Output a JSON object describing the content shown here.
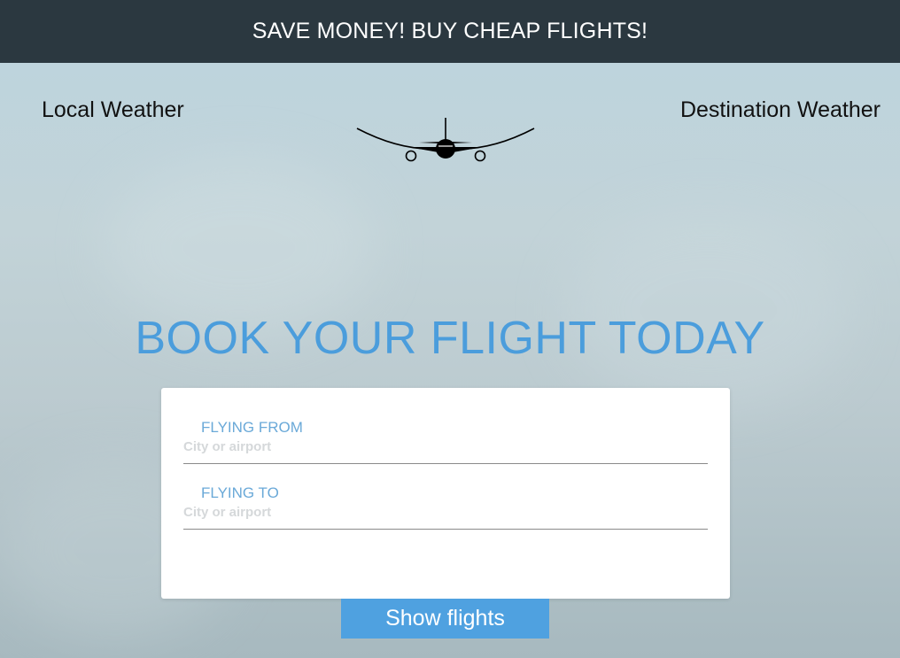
{
  "banner": {
    "text": "SAVE MONEY! BUY CHEAP FLIGHTS!"
  },
  "weather": {
    "local_label": "Local Weather",
    "destination_label": "Destination Weather"
  },
  "hero": {
    "headline": "BOOK YOUR FLIGHT TODAY"
  },
  "form": {
    "from": {
      "label": "FLYING FROM",
      "placeholder": "City or airport",
      "value": ""
    },
    "to": {
      "label": "FLYING TO",
      "placeholder": "City or airport",
      "value": ""
    },
    "submit_label": "Show flights"
  },
  "icons": {
    "logo": "airplane-icon"
  },
  "colors": {
    "banner_bg": "#2b3840",
    "accent": "#4fa1e0",
    "headline": "#4b9ddc",
    "field_label": "#6aa9d8"
  }
}
